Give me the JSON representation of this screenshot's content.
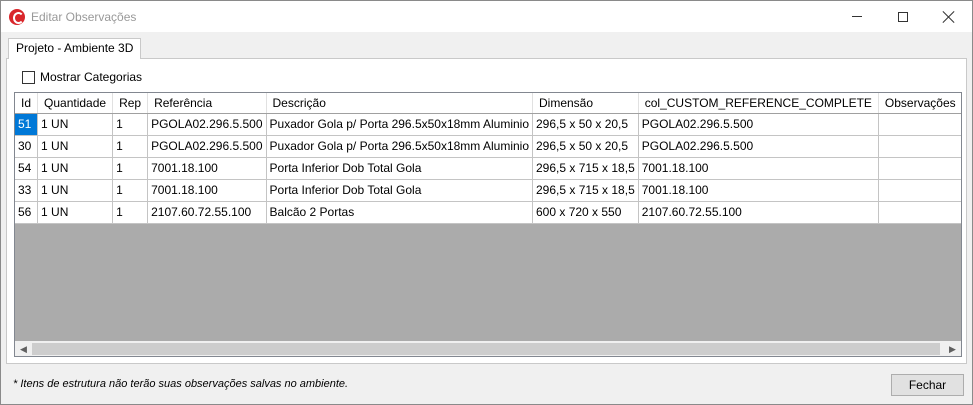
{
  "window": {
    "title": "Editar Observações",
    "min_icon": "minimize-icon",
    "max_icon": "maximize-icon",
    "close_icon": "close-icon"
  },
  "tabs": [
    {
      "label": "Projeto - Ambiente 3D",
      "active": true
    }
  ],
  "checkbox": {
    "label": "Mostrar Categorias",
    "checked": false
  },
  "grid": {
    "columns": [
      "Id",
      "Quantidade",
      "Rep",
      "Referência",
      "Descrição",
      "Dimensão",
      "col_CUSTOM_REFERENCE_COMPLETE",
      "Observações"
    ],
    "rows": [
      [
        "51",
        "1 UN",
        "1",
        "PGOLA02.296.5.500",
        "Puxador Gola p/ Porta 296.5x50x18mm Aluminio",
        "296,5 x 50 x 20,5",
        "PGOLA02.296.5.500",
        ""
      ],
      [
        "30",
        "1 UN",
        "1",
        "PGOLA02.296.5.500",
        "Puxador Gola p/ Porta 296.5x50x18mm Aluminio",
        "296,5 x 50 x 20,5",
        "PGOLA02.296.5.500",
        ""
      ],
      [
        "54",
        "1 UN",
        "1",
        "7001.18.100",
        "Porta Inferior Dob Total Gola",
        "296,5 x 715 x 18,5",
        "7001.18.100",
        ""
      ],
      [
        "33",
        "1 UN",
        "1",
        "7001.18.100",
        "Porta Inferior Dob Total Gola",
        "296,5 x 715 x 18,5",
        "7001.18.100",
        ""
      ],
      [
        "56",
        "1 UN",
        "1",
        "2107.60.72.55.100",
        "Balcão 2 Portas",
        "600 x 720 x 550",
        "2107.60.72.55.100",
        ""
      ]
    ],
    "selected_cell": {
      "row": 0,
      "col": 0
    },
    "selection_color": "#0078d7",
    "empty_area_color": "#ababab"
  },
  "footnote": "* Itens de estrutura não terão  suas observações salvas no ambiente.",
  "buttons": {
    "close_label": "Fechar"
  }
}
